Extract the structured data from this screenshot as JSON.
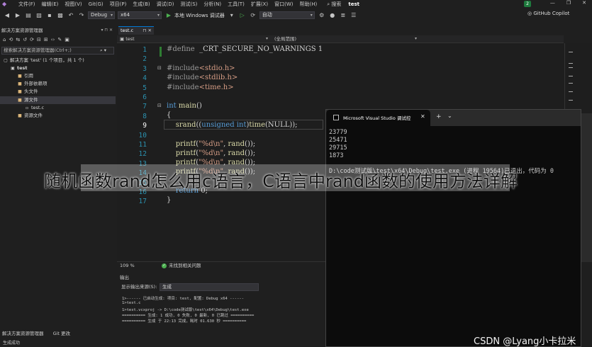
{
  "menu": {
    "items": [
      "文件(F)",
      "编辑(E)",
      "视图(V)",
      "Git(G)",
      "项目(P)",
      "生成(B)",
      "调试(D)",
      "测试(S)",
      "分析(N)",
      "工具(T)",
      "扩展(X)",
      "窗口(W)",
      "帮助(H)"
    ],
    "search": "搜索",
    "project": "test",
    "account_badge": "2",
    "window_buttons": [
      "—",
      "❐",
      "✕"
    ]
  },
  "toolbar": {
    "config": "Debug",
    "platform": "x64",
    "run_label": "本地 Windows 调试器",
    "auto": "自动",
    "copilot": "GitHub Copilot"
  },
  "solution": {
    "title": "解决方案资源管理器",
    "search_placeholder": "搜索解决方案资源管理器(Ctrl+;)",
    "tree": [
      {
        "label": "解决方案 'test' (1 个项目，共 1 个)",
        "indent": 0,
        "icon": "▢",
        "selected": false
      },
      {
        "label": "test",
        "indent": 1,
        "icon": "▣",
        "selected": false,
        "bold": true
      },
      {
        "label": "引用",
        "indent": 2,
        "icon": "▸",
        "selected": false
      },
      {
        "label": "外部依赖项",
        "indent": 2,
        "icon": "▸",
        "selected": false
      },
      {
        "label": "头文件",
        "indent": 2,
        "icon": "▸",
        "selected": false
      },
      {
        "label": "源文件",
        "indent": 2,
        "icon": "▾",
        "selected": true
      },
      {
        "label": "test.c",
        "indent": 3,
        "icon": "c",
        "selected": false
      },
      {
        "label": "资源文件",
        "indent": 2,
        "icon": "",
        "selected": false
      }
    ]
  },
  "editor": {
    "tab": "test.c",
    "nav_project": "test",
    "nav_scope": "(全局范围)",
    "line_numbers": [
      "1",
      "2",
      "3",
      "4",
      "5",
      "6",
      "7",
      "8",
      "9",
      "10",
      "11",
      "12",
      "13",
      "14",
      "15",
      "16",
      "17"
    ],
    "current_line": "9",
    "zoom": "109 %",
    "status": "未找到相关问题"
  },
  "output": {
    "title": "输出",
    "source_label": "显示输出来源(S):",
    "source_value": "生成",
    "lines": [
      "1>------ 已启动生成: 项目: test, 配置: Debug x64 ------",
      "1>test.c",
      "1>test.vcxproj -> D:\\code测试版\\test\\x64\\Debug\\test.exe",
      "========== 生成: 1 成功, 0 失败, 0 最新, 0 已跳过 ==========",
      "========== 生成 于 22:13 完成，耗时 01.630 秒 =========="
    ]
  },
  "bottom_tabs": [
    "解决方案资源管理器",
    "Git 更改"
  ],
  "statusbar": "生成成功",
  "console": {
    "title": "Microsoft Visual Studio 调试控",
    "lines": [
      "23779",
      "25471",
      "29715",
      "1873",
      "",
      "D:\\code测试版\\test\\x64\\Debug\\test.exe (进程 19564)已退出，代码为 0"
    ]
  },
  "overlay": {
    "headline": "随机函数rand怎么用c语言，C语言中rand函数的使用方法详解",
    "credit": "CSDN @Lyang小卡拉米"
  }
}
